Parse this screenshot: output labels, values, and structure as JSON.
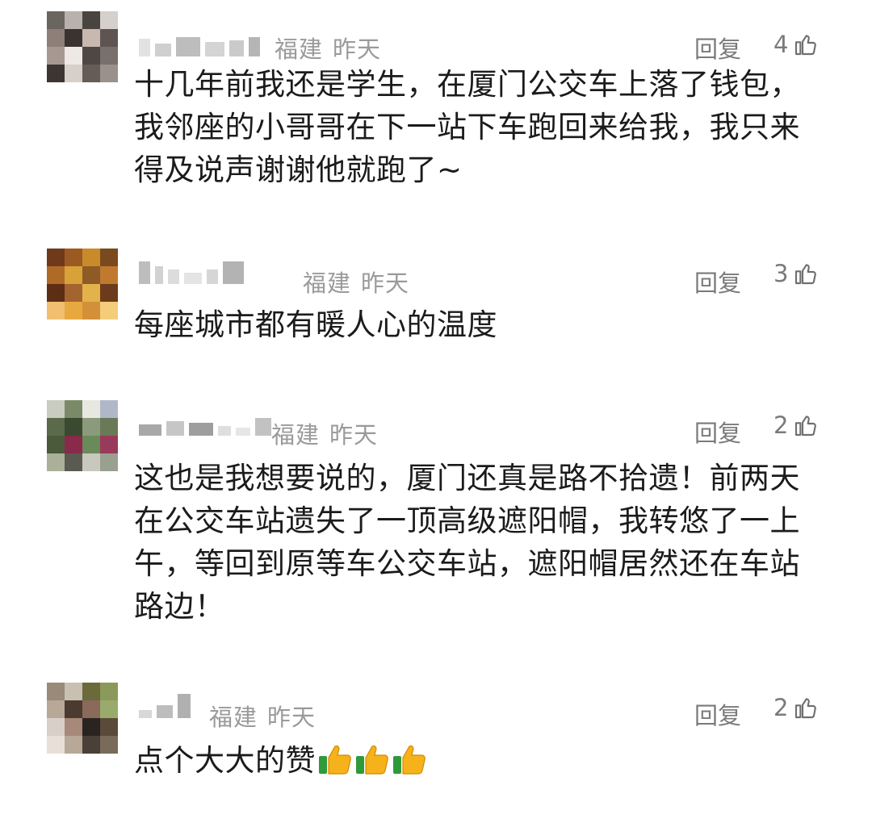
{
  "comments": [
    {
      "location": "福建",
      "time": "昨天",
      "reply_label": "回复",
      "likes": "4",
      "content_lines": [
        "十几年前我还是学生，在厦门公交车上落了钱包，",
        "我邻座的小哥哥在下一站下车跑回来给我，我只来",
        "得及说声谢谢他就跑了~"
      ]
    },
    {
      "location": "福建",
      "time": "昨天",
      "reply_label": "回复",
      "likes": "3",
      "content_lines": [
        "每座城市都有暖人心的温度"
      ]
    },
    {
      "location": "福建",
      "time": "昨天",
      "reply_label": "回复",
      "likes": "2",
      "content_lines": [
        "这也是我想要说的，厦门还真是路不拾遗！前两天",
        "在公交车站遗失了一顶高级遮阳帽，我转悠了一上",
        "午，等回到原等车公交车站，遮阳帽居然还在车站",
        "路边！"
      ]
    },
    {
      "location": "福建",
      "time": "昨天",
      "reply_label": "回复",
      "likes": "2",
      "content_lines": [
        "点个大大的赞"
      ],
      "emoji": [
        "thumbs-up-emoji",
        "thumbs-up-emoji",
        "thumbs-up-emoji"
      ]
    }
  ],
  "colors": {
    "text": "#1b1b1b",
    "meta": "#9a9a9a",
    "action": "#7a7a7a"
  }
}
